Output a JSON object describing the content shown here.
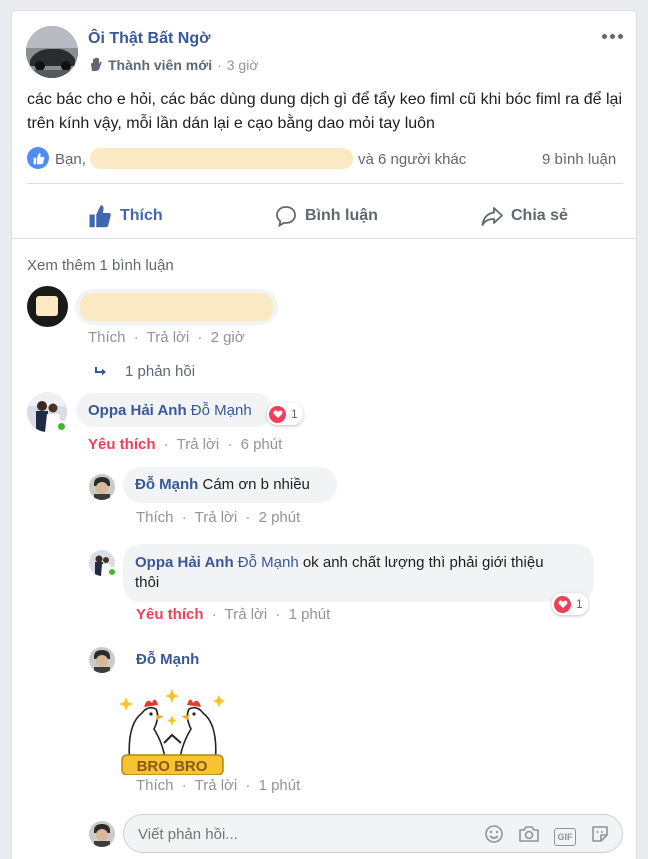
{
  "post": {
    "author": "Ôi Thật Bất Ngờ",
    "badge": "Thành viên mới",
    "time": "3 giờ",
    "text": "các bác cho e hỏi, các bác dùng dung dịch gì để tẩy keo fiml cũ khi bóc fiml ra để lại trên kính vậy, mỗi lần dán lại e cạo bằng dao mỏi tay luôn",
    "likes_prefix": "Bạn,",
    "likes_suffix": "và 6 người khác",
    "comment_count": "9 bình luận",
    "more_icon": "more-dots-icon"
  },
  "actions": {
    "like": "Thích",
    "comment": "Bình luận",
    "share": "Chia sẻ"
  },
  "see_more": "Xem thêm 1 bình luận",
  "comment1": {
    "like": "Thích",
    "reply": "Trả lời",
    "time": "2 giờ",
    "replies": "1 phản hồi"
  },
  "comment2": {
    "name": "Oppa Hải Anh",
    "mention": "Đỗ Mạnh",
    "reactions": "1",
    "liked": "Yêu thích",
    "reply": "Trả lời",
    "time": "6 phút"
  },
  "reply1": {
    "name": "Đỗ Mạnh",
    "text": "Cám ơn b nhiều",
    "like": "Thích",
    "reply": "Trả lời",
    "time": "2 phút"
  },
  "reply2": {
    "name": "Oppa Hải Anh",
    "mention": "Đỗ Mạnh",
    "text_line1": "ok anh chất lượng thì phải giới thiệu",
    "text_line2": "thôi",
    "reactions": "1",
    "liked": "Yêu thích",
    "reply": "Trả lời",
    "time": "1 phút"
  },
  "reply3": {
    "name": "Đỗ Mạnh",
    "sticker_text": "BRO BRO",
    "like": "Thích",
    "reply": "Trả lời",
    "time": "1 phút"
  },
  "composer": {
    "placeholder": "Viết phản hồi...",
    "gif_label": "GIF"
  },
  "separator": "·",
  "colors": {
    "link": "#385898",
    "like_blue": "#4267b2",
    "love_red": "#f33e58",
    "online": "#42b72a",
    "highlight": "#fbe9c4"
  }
}
